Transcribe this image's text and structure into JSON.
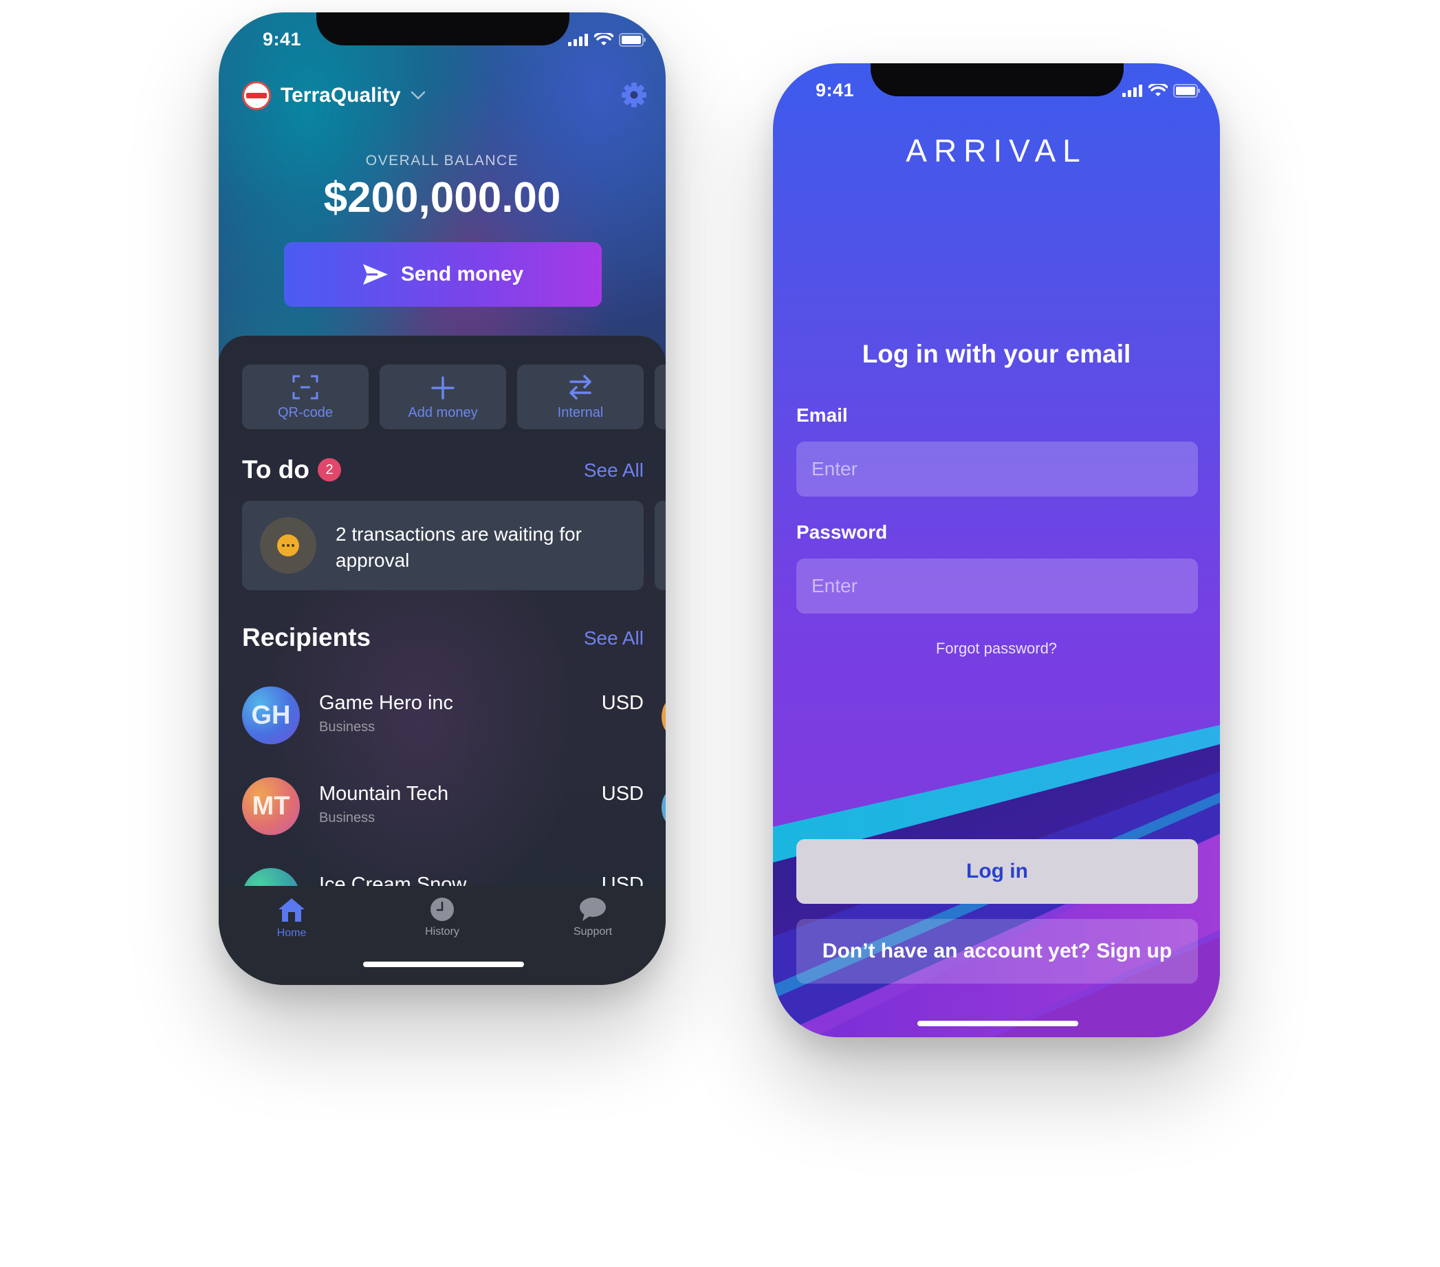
{
  "left_phone": {
    "status": {
      "time": "9:41"
    },
    "header": {
      "account_name": "TerraQuality"
    },
    "balance": {
      "label": "OVERALL BALANCE",
      "value": "$200,000.00"
    },
    "send_button": {
      "label": "Send money"
    },
    "quick_actions": [
      {
        "label": "QR-code",
        "icon": "qr-scan-icon"
      },
      {
        "label": "Add money",
        "icon": "plus-icon"
      },
      {
        "label": "Internal",
        "icon": "transfer-arrows-icon"
      }
    ],
    "todo": {
      "title": "To do",
      "badge_count": "2",
      "see_all": "See All",
      "card_text": "2 transactions are waiting for approval"
    },
    "recipients": {
      "title": "Recipients",
      "see_all": "See All",
      "items": [
        {
          "initials": "GH",
          "name": "Game Hero inc",
          "type": "Business",
          "currency": "USD"
        },
        {
          "initials": "MT",
          "name": "Mountain Tech",
          "type": "Business",
          "currency": "USD"
        },
        {
          "initials": "",
          "name": "Ice Cream Snow",
          "type": "",
          "currency": "USD"
        }
      ]
    },
    "tabs": [
      {
        "label": "Home",
        "icon": "home-icon",
        "active": true
      },
      {
        "label": "History",
        "icon": "clock-icon",
        "active": false
      },
      {
        "label": "Support",
        "icon": "chat-bubble-icon",
        "active": false
      }
    ],
    "colors": {
      "accent": "#6f82f0",
      "badge": "#e0476a",
      "send_start": "#4a5cf2",
      "send_end": "#a63ae6"
    }
  },
  "right_phone": {
    "status": {
      "time": "9:41"
    },
    "brand": "ARRIVAL",
    "title": "Log in with your email",
    "email": {
      "label": "Email",
      "placeholder": "Enter"
    },
    "password": {
      "label": "Password",
      "placeholder": "Enter"
    },
    "forgot": "Forgot password?",
    "login_button": "Log in",
    "signup_button": "Don’t have an account yet? Sign up",
    "colors": {
      "bg_top": "#3d5bec",
      "bg_bottom": "#8a36d8",
      "login_text": "#2942cc"
    }
  }
}
